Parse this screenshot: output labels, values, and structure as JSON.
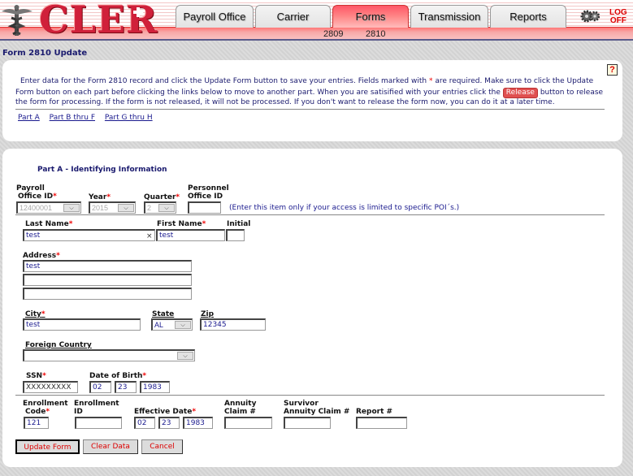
{
  "app": {
    "logo": "CLER",
    "logoff_line1": "LOG",
    "logoff_line2": "OFF"
  },
  "nav": {
    "tabs": [
      {
        "label": "Payroll Office",
        "active": false
      },
      {
        "label": "Carrier",
        "active": false
      },
      {
        "label": "Forms",
        "active": true
      },
      {
        "label": "Transmission",
        "active": false
      },
      {
        "label": "Reports",
        "active": false
      }
    ],
    "subnav": [
      "2809",
      "2810"
    ]
  },
  "page": {
    "title": "Form 2810 Update",
    "help_label": "?",
    "instructions_line1_a": "Enter data for the Form 2810 record and click the Update Form button to save your entries.  Fields marked with ",
    "instructions_line1_b": " are required.  Make sure to click the Update",
    "instructions_line2_a": "Form button on each part before clicking the links below to move to another part.  When you are satisified with your entries click the ",
    "instructions_line2_b": " button to release the form for processing.  If the form is not released, it will not be processed.  If you don't want to release the form now, you can do it at a later time.",
    "required_marker": "*",
    "release_label": "Release",
    "part_links": [
      "Part A",
      "Part B thru F",
      "Part G thru H"
    ]
  },
  "form": {
    "section_title": "Part A - Identifying Information",
    "payroll_office_label_1": "Payroll",
    "payroll_office_label_2": "Office ID",
    "payroll_office_value": "12400001",
    "year_label": "Year",
    "year_value": "2015",
    "quarter_label": "Quarter",
    "quarter_value": "2",
    "personnel_office_label_1": "Personnel",
    "personnel_office_label_2": "Office ID",
    "personnel_office_value": "",
    "personnel_note": "(Enter this item only if your access is limited to specific POI´s.)",
    "last_name_label": "Last Name",
    "last_name_value": "test",
    "clear_glyph": "×",
    "first_name_label": "First Name",
    "first_name_value": "test",
    "initial_label": "Initial",
    "initial_value": "",
    "address_label": "Address",
    "address_1": "test",
    "address_2": "",
    "address_3": "",
    "city_label": "City",
    "city_value": "test",
    "state_label": "State",
    "state_value": "AL",
    "zip_label": "Zip",
    "zip_value": "12345",
    "foreign_country_label": "Foreign Country",
    "foreign_country_value": "",
    "ssn_label": "SSN",
    "ssn_value": "XXXXXXXXX",
    "dob_label": "Date of Birth",
    "dob_month": "02",
    "dob_day": "23",
    "dob_year": "1983",
    "enrollment_code_label_1": "Enrollment",
    "enrollment_code_label_2": "Code",
    "enrollment_code_value": "121",
    "enrollment_id_label_1": "Enrollment",
    "enrollment_id_label_2": "ID",
    "enrollment_id_value": "",
    "effective_date_label": "Effective Date",
    "eff_month": "02",
    "eff_day": "23",
    "eff_year": "1983",
    "annuity_claim_label_1": "Annuity",
    "annuity_claim_label_2": "Claim #",
    "annuity_claim_value": "",
    "survivor_label_1": "Survivor",
    "survivor_label_2": "Annuity Claim #",
    "survivor_value": "",
    "report_label": "Report #",
    "report_value": "",
    "dropdown_glyph": "⌵"
  },
  "buttons": {
    "update": "Update Form",
    "clear": "Clear Data",
    "cancel": "Cancel"
  }
}
